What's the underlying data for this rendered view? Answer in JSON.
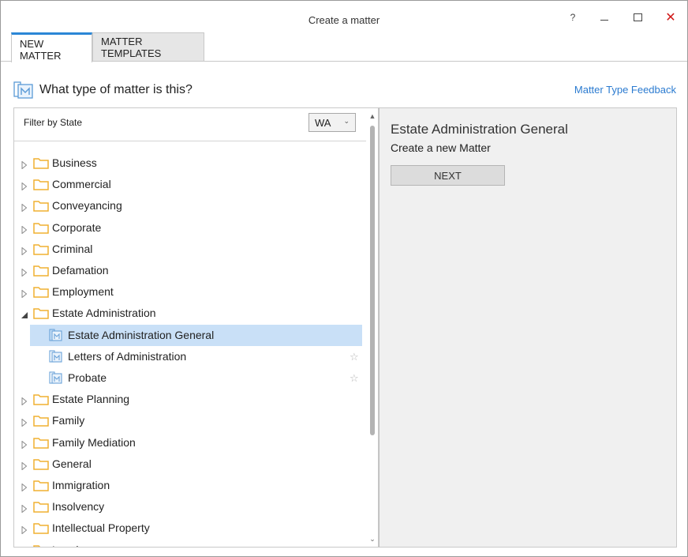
{
  "window": {
    "title": "Create a matter",
    "help_label": "?",
    "close_label": "✕"
  },
  "tabs": [
    {
      "label": "NEW MATTER",
      "active": true
    },
    {
      "label": "MATTER TEMPLATES",
      "active": false
    }
  ],
  "heading": {
    "text": "What type of matter is this?",
    "feedback_link": "Matter Type Feedback"
  },
  "filter": {
    "label": "Filter by State",
    "selected": "WA"
  },
  "tree": {
    "items": [
      {
        "label": "Business",
        "expanded": false
      },
      {
        "label": "Commercial",
        "expanded": false
      },
      {
        "label": "Conveyancing",
        "expanded": false
      },
      {
        "label": "Corporate",
        "expanded": false
      },
      {
        "label": "Criminal",
        "expanded": false
      },
      {
        "label": "Defamation",
        "expanded": false
      },
      {
        "label": "Employment",
        "expanded": false
      },
      {
        "label": "Estate Administration",
        "expanded": true,
        "children": [
          {
            "label": "Estate Administration General",
            "selected": true
          },
          {
            "label": "Letters of Administration",
            "selected": false
          },
          {
            "label": "Probate",
            "selected": false
          }
        ]
      },
      {
        "label": "Estate Planning",
        "expanded": false
      },
      {
        "label": "Family",
        "expanded": false
      },
      {
        "label": "Family Mediation",
        "expanded": false
      },
      {
        "label": "General",
        "expanded": false
      },
      {
        "label": "Immigration",
        "expanded": false
      },
      {
        "label": "Insolvency",
        "expanded": false
      },
      {
        "label": "Intellectual Property",
        "expanded": false
      },
      {
        "label": "Leasing",
        "expanded": false
      }
    ]
  },
  "detail": {
    "title": "Estate Administration General",
    "subtitle": "Create a new Matter",
    "next_label": "NEXT"
  },
  "colors": {
    "accent": "#2b87d6",
    "selection": "#c9e0f7",
    "folder": "#f5b936",
    "link": "#2b7bd0",
    "close": "#d01818"
  }
}
